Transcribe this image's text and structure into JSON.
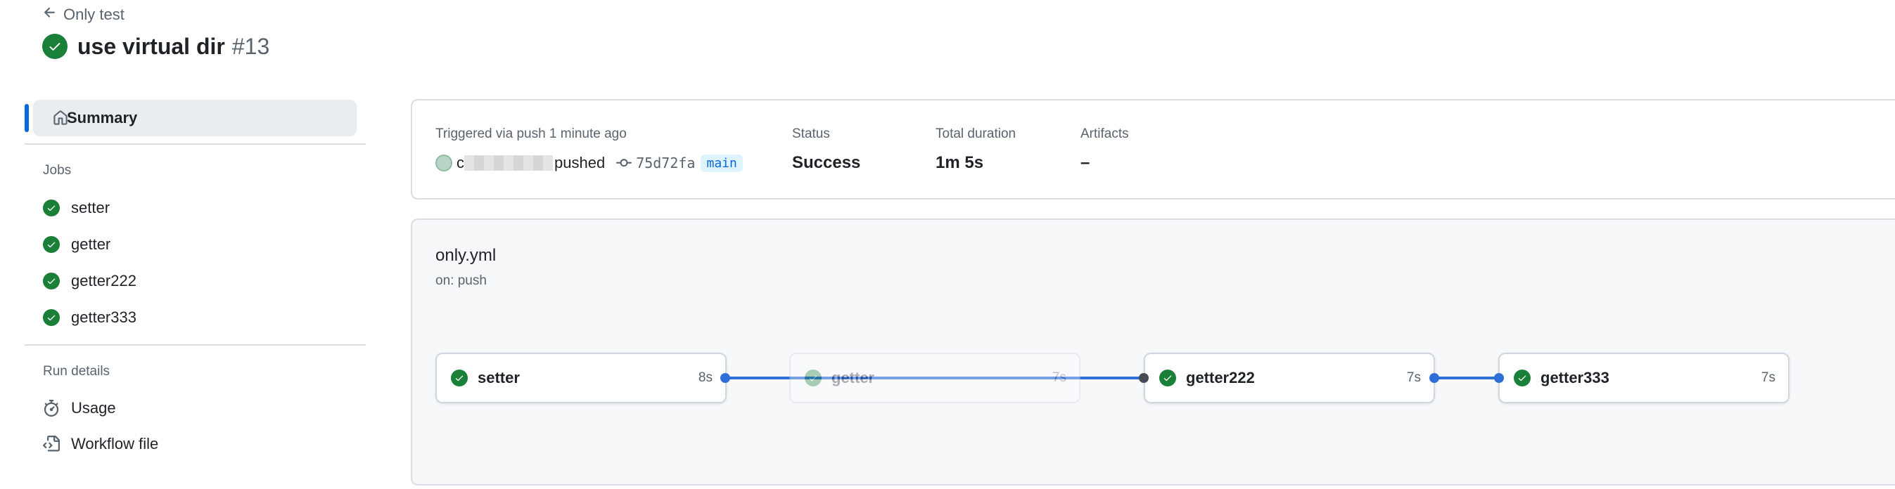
{
  "header": {
    "back_label": "Only test",
    "run_title": "use virtual dir",
    "run_number": "#13"
  },
  "sidebar": {
    "summary_label": "Summary",
    "jobs_heading": "Jobs",
    "jobs": [
      {
        "label": "setter"
      },
      {
        "label": "getter"
      },
      {
        "label": "getter222"
      },
      {
        "label": "getter333"
      }
    ],
    "run_details_heading": "Run details",
    "details": [
      {
        "label": "Usage",
        "icon": "stopwatch-icon"
      },
      {
        "label": "Workflow file",
        "icon": "file-code-icon"
      }
    ]
  },
  "summary": {
    "trigger_label": "Triggered via push 1 minute ago",
    "actor_initial": "c",
    "pushed_text": "pushed",
    "commit_sha": "75d72fa",
    "branch": "main",
    "status_label": "Status",
    "status_value": "Success",
    "duration_label": "Total duration",
    "duration_value": "1m 5s",
    "artifacts_label": "Artifacts",
    "artifacts_value": "–"
  },
  "workflow": {
    "file_name": "only.yml",
    "trigger": "on: push",
    "jobs": [
      {
        "name": "setter",
        "duration": "8s",
        "faded": false
      },
      {
        "name": "getter",
        "duration": "7s",
        "faded": true
      },
      {
        "name": "getter222",
        "duration": "7s",
        "faded": false
      },
      {
        "name": "getter333",
        "duration": "7s",
        "faded": false
      }
    ]
  },
  "colors": {
    "success": "#1a7f37",
    "accent": "#0969da",
    "edge": "#2f6fd8"
  }
}
